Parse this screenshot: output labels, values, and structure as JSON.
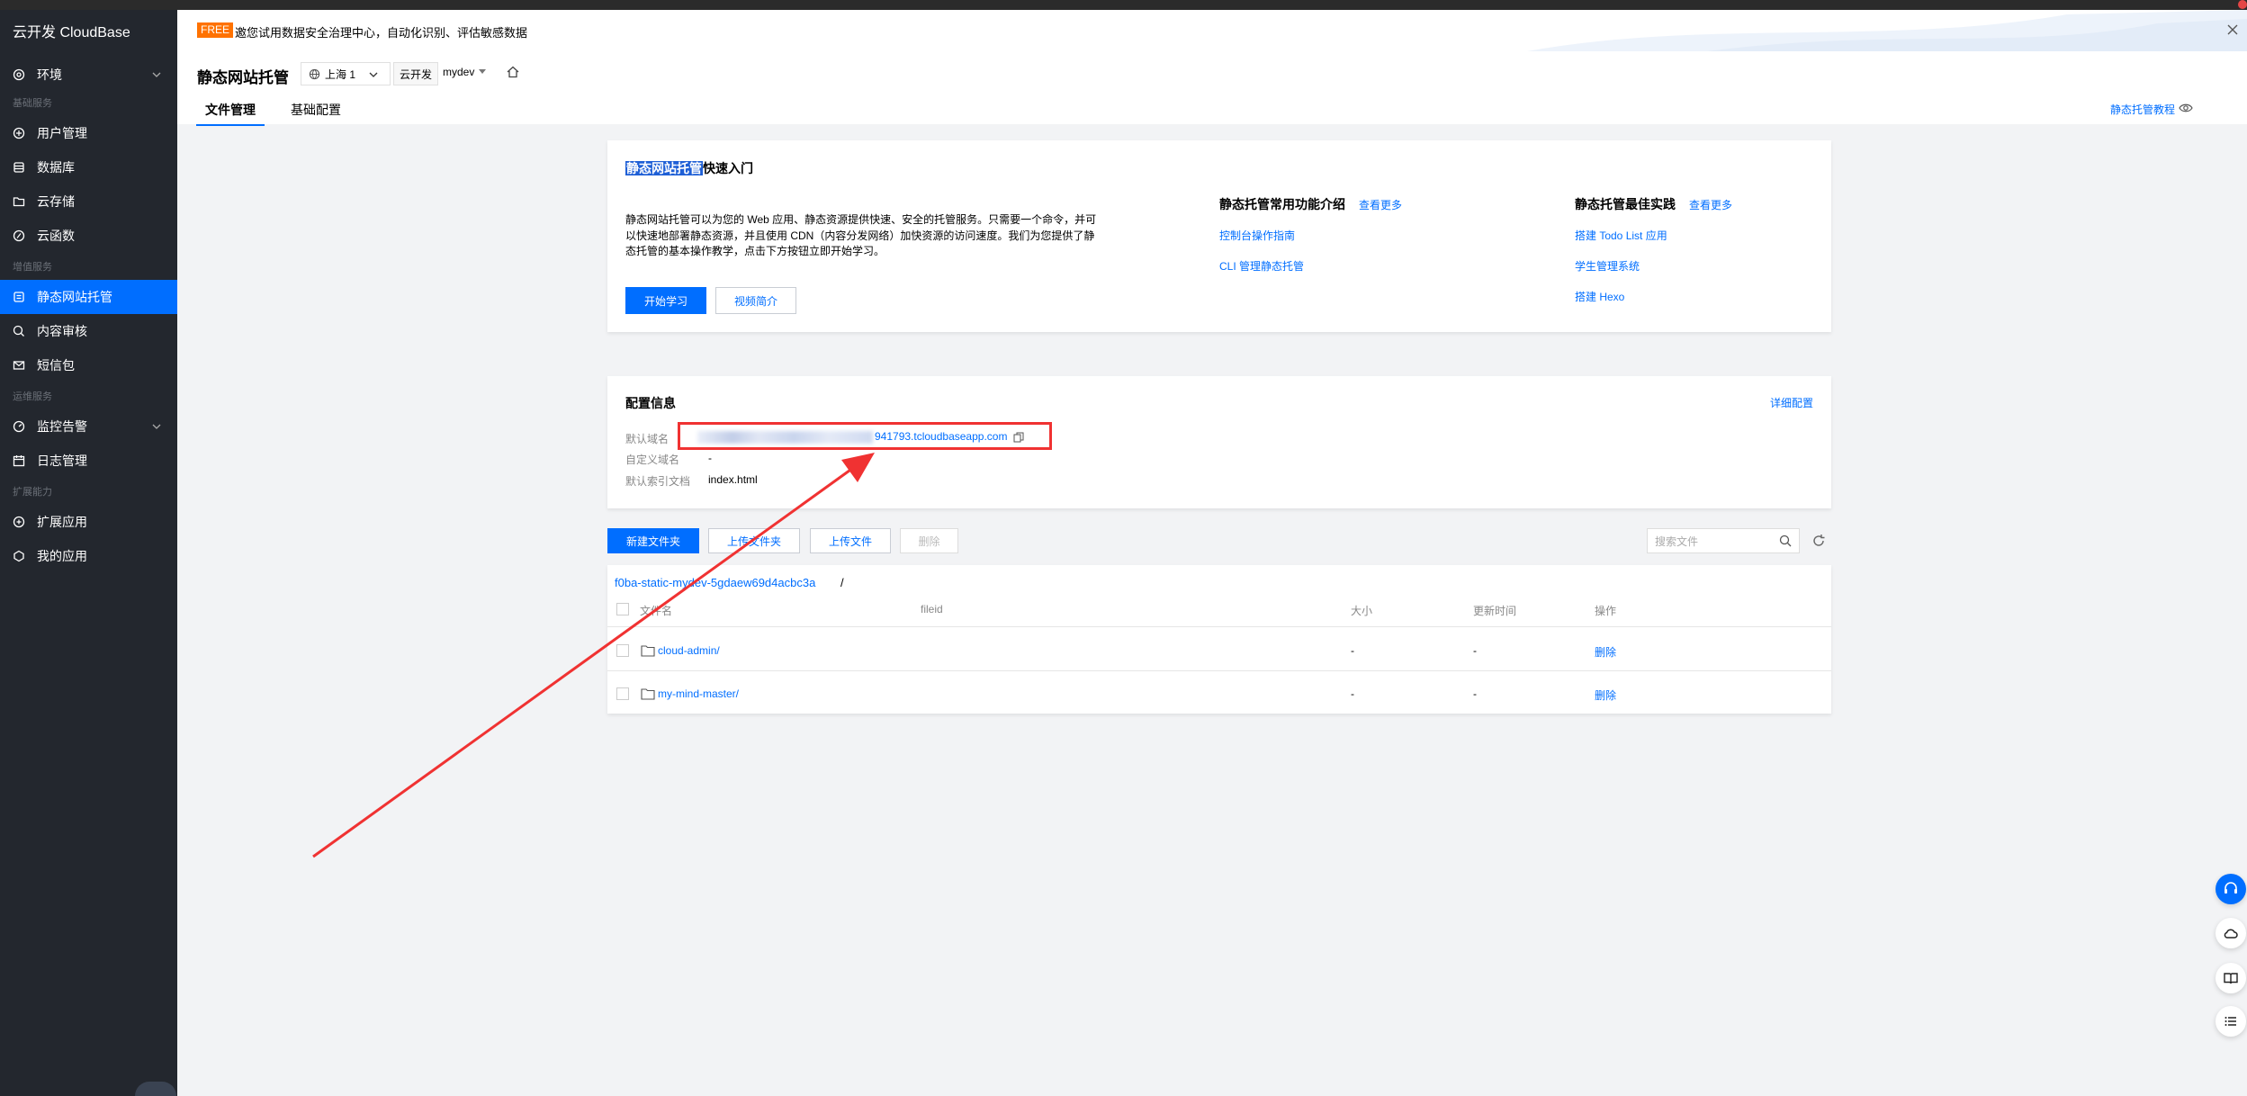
{
  "app": {
    "brand": "云开发 CloudBase"
  },
  "sidebar": {
    "env": "环境",
    "groups": {
      "basic": "基础服务",
      "value": "增值服务",
      "ops": "运维服务",
      "ext": "扩展能力"
    },
    "items": {
      "users": "用户管理",
      "database": "数据库",
      "storage": "云存储",
      "functions": "云函数",
      "hosting": "静态网站托管",
      "audit": "内容审核",
      "sms": "短信包",
      "monitor": "监控告警",
      "logs": "日志管理",
      "extapps": "扩展应用",
      "myapps": "我的应用"
    }
  },
  "banner": {
    "tag": "FREE",
    "text": "邀您试用数据安全治理中心，自动化识别、评估敏感数据"
  },
  "header": {
    "title": "静态网站托管",
    "region": "上海 1",
    "env_label": "云开发",
    "env_name": "mydev",
    "tabs": {
      "files": "文件管理",
      "config": "基础配置"
    },
    "tutorial": "静态托管教程"
  },
  "quickstart": {
    "title_highlight": "静态网站托管",
    "title_rest": "快速入门",
    "desc": "静态网站托管可以为您的 Web 应用、静态资源提供快速、安全的托管服务。只需要一个命令，并可以快速地部署静态资源，并且使用 CDN（内容分发网络）加快资源的访问速度。我们为您提供了静态托管的基本操作教学，点击下方按钮立即开始学习。",
    "btn_start": "开始学习",
    "btn_video": "视频简介",
    "features_title": "静态托管常用功能介绍",
    "features_more": "查看更多",
    "features": {
      "console": "控制台操作指南",
      "cli": "CLI 管理静态托管"
    },
    "practice_title": "静态托管最佳实践",
    "practice_more": "查看更多",
    "practice": {
      "todo": "搭建 Todo List 应用",
      "students": "学生管理系统",
      "hexo": "搭建 Hexo"
    }
  },
  "config": {
    "title": "配置信息",
    "detail_link": "详细配置",
    "domain_label": "默认域名",
    "domain_tail": "941793.tcloudbaseapp.com",
    "custom_label": "自定义域名",
    "custom_value": "-",
    "index_label": "默认索引文档",
    "index_value": "index.html"
  },
  "toolbar": {
    "new_folder": "新建文件夹",
    "upload_folder": "上传文件夹",
    "upload_file": "上传文件",
    "delete": "删除",
    "search_placeholder": "搜索文件"
  },
  "files": {
    "bucket": "f0ba-static-mydev-5gdaew69d4acbc3a",
    "slash": "/",
    "columns": {
      "name": "文件名",
      "fileid": "fileid",
      "size": "大小",
      "updated": "更新时间",
      "actions": "操作"
    },
    "rows": [
      {
        "name": "cloud-admin/",
        "size": "-",
        "updated": "-",
        "action": "删除"
      },
      {
        "name": "my-mind-master/",
        "size": "-",
        "updated": "-",
        "action": "删除"
      }
    ]
  },
  "colors": {
    "accent": "#006eff",
    "sidebar": "#23272e",
    "annotation": "#f03232",
    "free_tag": "#ff7200"
  }
}
